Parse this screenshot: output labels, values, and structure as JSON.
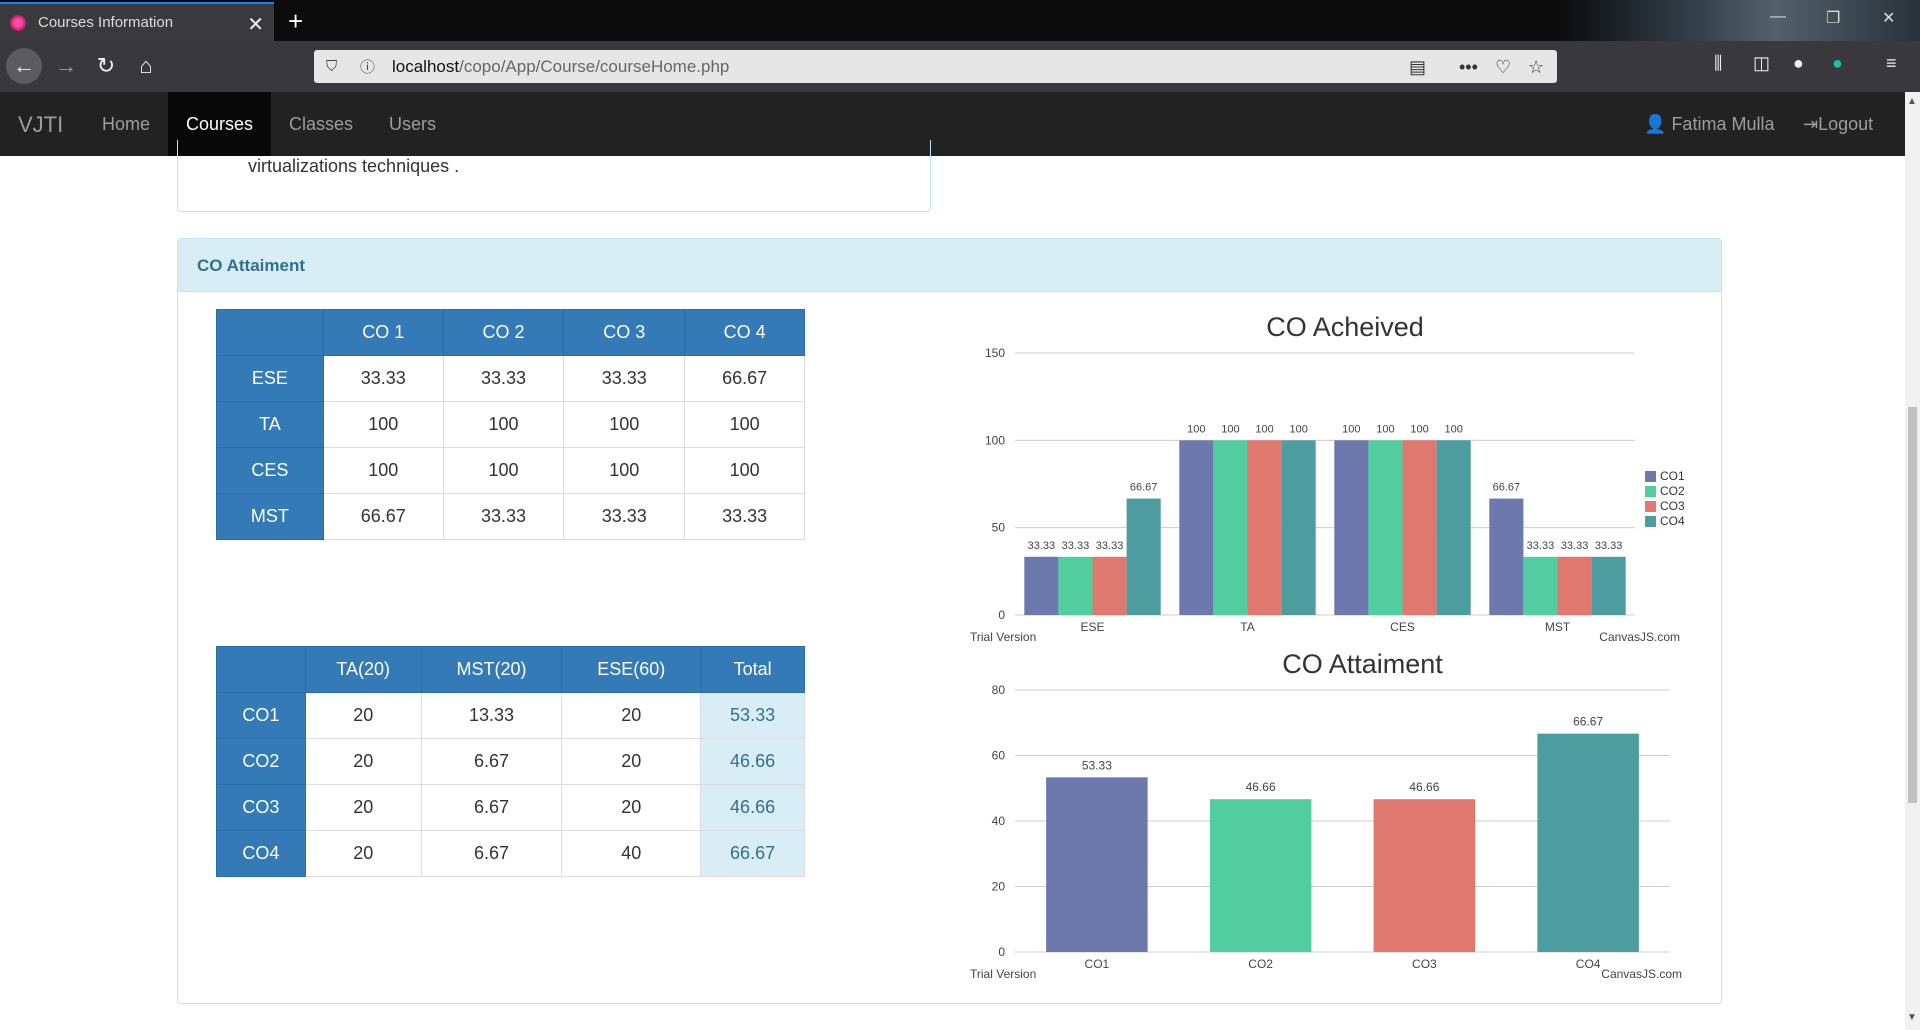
{
  "browser": {
    "tab_title": "Courses Information",
    "url_host": "localhost",
    "url_path": "/copo/App/Course/courseHome.php"
  },
  "navbar": {
    "brand": "VJTI",
    "items": [
      "Home",
      "Courses",
      "Classes",
      "Users"
    ],
    "user": "Fatima Mulla",
    "logout": "Logout"
  },
  "prev_panel_text": "virtualizations techniques .",
  "panel": {
    "heading": "CO Attaiment"
  },
  "table1": {
    "headers": [
      "",
      "CO 1",
      "CO 2",
      "CO 3",
      "CO 4"
    ],
    "rows": [
      {
        "label": "ESE",
        "cells": [
          "33.33",
          "33.33",
          "33.33",
          "66.67"
        ]
      },
      {
        "label": "TA",
        "cells": [
          "100",
          "100",
          "100",
          "100"
        ]
      },
      {
        "label": "CES",
        "cells": [
          "100",
          "100",
          "100",
          "100"
        ]
      },
      {
        "label": "MST",
        "cells": [
          "66.67",
          "33.33",
          "33.33",
          "33.33"
        ]
      }
    ]
  },
  "table2": {
    "headers": [
      "",
      "TA(20)",
      "MST(20)",
      "ESE(60)",
      "Total"
    ],
    "rows": [
      {
        "label": "CO1",
        "cells": [
          "20",
          "13.33",
          "20",
          "53.33"
        ]
      },
      {
        "label": "CO2",
        "cells": [
          "20",
          "6.67",
          "20",
          "46.66"
        ]
      },
      {
        "label": "CO3",
        "cells": [
          "20",
          "6.67",
          "20",
          "46.66"
        ]
      },
      {
        "label": "CO4",
        "cells": [
          "20",
          "6.67",
          "40",
          "66.67"
        ]
      }
    ]
  },
  "chart_data": [
    {
      "type": "bar",
      "title": "CO Acheived",
      "categories": [
        "ESE",
        "TA",
        "CES",
        "MST"
      ],
      "series": [
        {
          "name": "CO1",
          "color": "#6D78AD",
          "values": [
            33.33,
            100,
            100,
            66.67
          ]
        },
        {
          "name": "CO2",
          "color": "#51CDA0",
          "values": [
            33.33,
            100,
            100,
            33.33
          ]
        },
        {
          "name": "CO3",
          "color": "#DF7970",
          "values": [
            33.33,
            100,
            100,
            33.33
          ]
        },
        {
          "name": "CO4",
          "color": "#4C9CA0",
          "values": [
            66.67,
            100,
            100,
            33.33
          ]
        }
      ],
      "ylim": [
        0,
        150
      ],
      "yticks": [
        0,
        50,
        100,
        150
      ],
      "legend": "right",
      "footer_left": "Trial Version",
      "footer_right": "CanvasJS.com"
    },
    {
      "type": "bar",
      "title": "CO Attaiment",
      "categories": [
        "CO1",
        "CO2",
        "CO3",
        "CO4"
      ],
      "values": [
        53.33,
        46.66,
        46.66,
        66.67
      ],
      "colors": [
        "#6D78AD",
        "#51CDA0",
        "#DF7970",
        "#4C9CA0"
      ],
      "ylim": [
        0,
        80
      ],
      "yticks": [
        0,
        20,
        40,
        60,
        80
      ],
      "footer_left": "Trial Version",
      "footer_right": "CanvasJS.com"
    }
  ]
}
